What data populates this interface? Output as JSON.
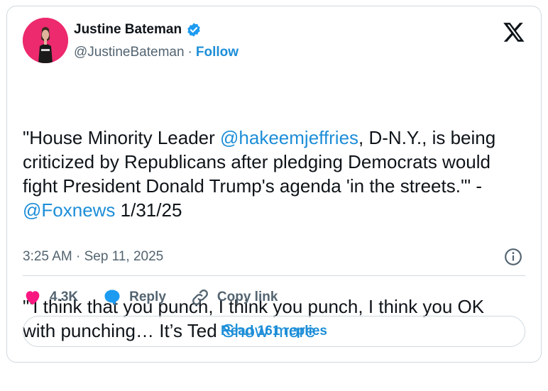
{
  "author": {
    "name": "Justine Bateman",
    "handle": "@JustineBateman",
    "separator": "·",
    "follow_label": "Follow"
  },
  "tweet": {
    "p1_a": "\"House Minority Leader ",
    "p1_mention": "@hakeemjeffries",
    "p1_b": ", D-N.Y., is being criticized by Republicans after pledging Democrats would fight President Donald Trump's agenda 'in the streets.'\" - ",
    "p1_source": "@Foxnews",
    "p1_c": " 1/31/25",
    "p2_text": "\"'I think that you punch, I think you punch, I think you OK with punching… It’s Ted ",
    "show_more": "Show more"
  },
  "timestamp": "3:25 AM · Sep 11, 2025",
  "actions": {
    "likes": "4.3K",
    "reply_label": "Reply",
    "copy_link_label": "Copy link"
  },
  "read_replies_label": "Read 161 replies",
  "colors": {
    "accent": "#1d8ed8",
    "like": "#f91880",
    "muted": "#536471",
    "border": "#cfd9de",
    "avatar_bg": "#ed2a6e"
  },
  "icons": [
    "verified-badge-icon",
    "x-logo-icon",
    "info-icon",
    "heart-icon",
    "reply-icon",
    "link-icon"
  ]
}
